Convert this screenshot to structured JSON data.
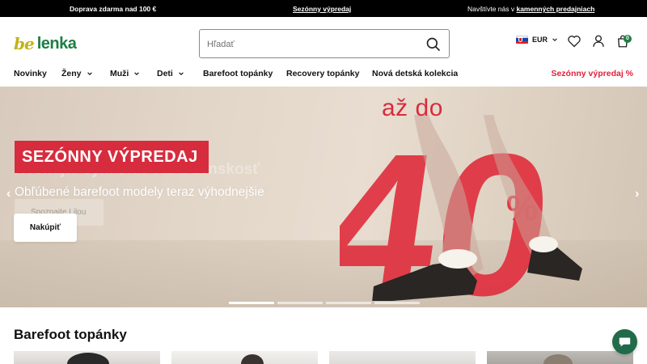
{
  "topbar": {
    "shipping": "Doprava zdarma nad 100 €",
    "sale_link": "Sezónny výpredaj",
    "stores_prefix": "Navštívte nás v ",
    "stores_link": "kamenných predajniach"
  },
  "header": {
    "logo_be": "be",
    "logo_name": "lenka",
    "search_placeholder": "Hľadať",
    "currency": "EUR",
    "cart_count": "0",
    "colors": {
      "brand_green": "#1f7d44",
      "brand_yellow": "#c3b219",
      "sale_red": "#e21f3a"
    }
  },
  "nav": {
    "items": [
      {
        "label": "Novinky",
        "dropdown": false
      },
      {
        "label": "Ženy",
        "dropdown": true
      },
      {
        "label": "Muži",
        "dropdown": true
      },
      {
        "label": "Deti",
        "dropdown": true
      },
      {
        "label": "Barefoot topánky",
        "dropdown": false
      },
      {
        "label": "Recovery topánky",
        "dropdown": false
      },
      {
        "label": "Nová detská kolekcia",
        "dropdown": false
      }
    ],
    "sale": "Sezónny výpredaj %"
  },
  "hero": {
    "title": "SEZÓNNY VÝPREDAJ",
    "subtitle": "Obľúbené barefoot modely teraz výhodnejšie",
    "cta": "Nakúpiť",
    "ghost_heading": "Nechajte vyniknúť vašu ženskosť",
    "ghost_button": "Spoznajte Lilou",
    "discount_prefix": "až do",
    "discount_value": "40",
    "discount_unit": "%",
    "slides": 4,
    "active_slide": 1
  },
  "section": {
    "title": "Barefoot topánky"
  },
  "icons": {
    "search": "search-icon",
    "wishlist": "heart-icon",
    "account": "user-icon",
    "cart": "cart-icon",
    "chat": "chat-icon"
  }
}
